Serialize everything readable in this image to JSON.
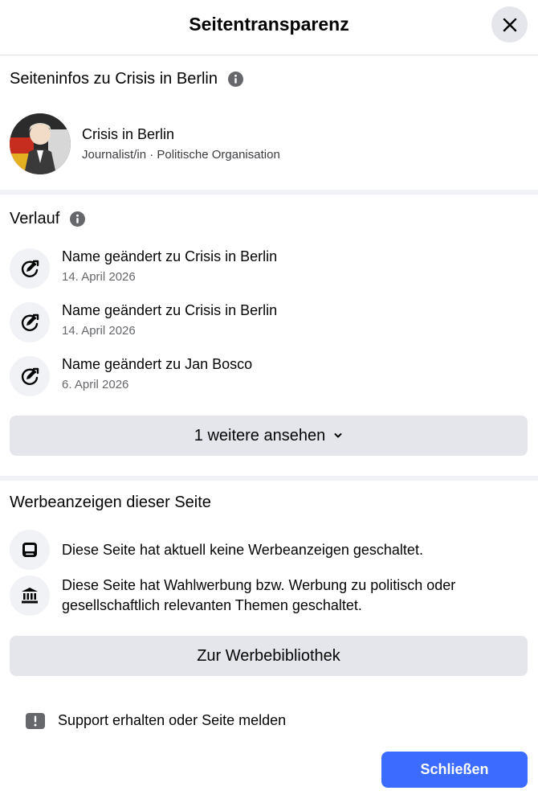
{
  "header": {
    "title": "Seitentransparenz"
  },
  "page_info": {
    "section_title": "Seiteninfos zu Crisis in Berlin",
    "page_name": "Crisis in Berlin",
    "category": "Journalist/in · Politische Organisation"
  },
  "history": {
    "section_title": "Verlauf",
    "items": [
      {
        "title": "Name geändert zu Crisis in Berlin",
        "date": "14. April 2026",
        "icon": "edit-refresh-icon"
      },
      {
        "title": "Name geändert zu Crisis in Berlin",
        "date": "14. April 2026",
        "icon": "edit-refresh-icon"
      },
      {
        "title": "Name geändert zu Jan Bosco",
        "date": "6. April 2026",
        "icon": "edit-refresh-icon"
      }
    ],
    "more_label": "1 weitere ansehen"
  },
  "ads": {
    "section_title": "Werbeanzeigen dieser Seite",
    "items": [
      {
        "text": "Diese Seite hat aktuell keine Werbeanzeigen geschaltet.",
        "icon": "device-icon"
      },
      {
        "text": "Diese Seite hat Wahlwerbung bzw. Werbung zu politisch oder gesellschaftlich relevanten Themen geschaltet.",
        "icon": "government-building-icon"
      }
    ],
    "library_label": "Zur Werbebibliothek"
  },
  "support": {
    "label": "Support erhalten oder Seite melden",
    "icon": "report-icon"
  },
  "footer": {
    "close_label": "Schließen"
  },
  "colors": {
    "primary": "#3b6cff",
    "button_gray": "#e4e6eb",
    "divider": "#f0f2f5",
    "secondary_text": "#65676b"
  }
}
